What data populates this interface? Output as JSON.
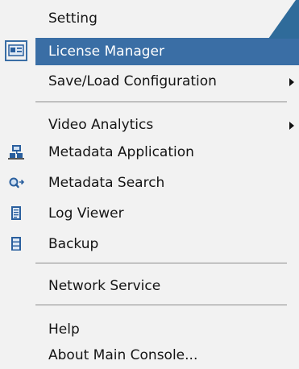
{
  "menu": {
    "items": [
      {
        "label": "Setting",
        "icon": null,
        "highlighted": false,
        "has_submenu": false
      },
      {
        "label": "License Manager",
        "icon": "license-card-icon",
        "highlighted": true,
        "has_submenu": false
      },
      {
        "label": "Save/Load Configuration",
        "icon": null,
        "highlighted": false,
        "has_submenu": true
      },
      {
        "label": "Video Analytics",
        "icon": null,
        "highlighted": false,
        "has_submenu": true
      },
      {
        "label": "Metadata Application",
        "icon": "metadata-application-icon",
        "highlighted": false,
        "has_submenu": false
      },
      {
        "label": "Metadata Search",
        "icon": "metadata-search-icon",
        "highlighted": false,
        "has_submenu": false
      },
      {
        "label": "Log Viewer",
        "icon": "log-viewer-icon",
        "highlighted": false,
        "has_submenu": false
      },
      {
        "label": "Backup",
        "icon": "backup-icon",
        "highlighted": false,
        "has_submenu": false
      },
      {
        "label": "Network Service",
        "icon": null,
        "highlighted": false,
        "has_submenu": false
      },
      {
        "label": "Help",
        "icon": null,
        "highlighted": false,
        "has_submenu": false
      },
      {
        "label": "About Main Console...",
        "icon": null,
        "highlighted": false,
        "has_submenu": false
      }
    ]
  },
  "colors": {
    "menu_background": "#f2f2f2",
    "highlight": "#3a6ea5",
    "highlight_text": "#ffffff",
    "text": "#141414",
    "pointer_arrow": "#2f6b9a",
    "icon_blue": "#2a5f9e"
  }
}
